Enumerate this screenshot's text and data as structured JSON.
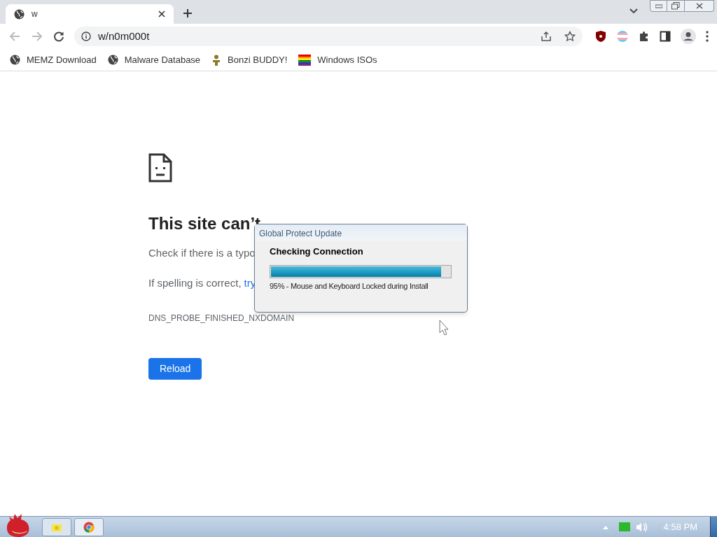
{
  "browser": {
    "tabs": [
      {
        "title": "w",
        "selected": true
      }
    ],
    "address": "w/n0m000t",
    "bookmarks": [
      {
        "kind": "globe",
        "label": "MEMZ Download"
      },
      {
        "kind": "globe",
        "label": "Malware Database"
      },
      {
        "kind": "figure",
        "label": "Bonzi BUDDY!"
      },
      {
        "kind": "rainbow",
        "label": "Windows ISOs"
      }
    ]
  },
  "error_page": {
    "heading": "This site can’t",
    "line_1": "Check if there is a typo",
    "line_2": "If spelling is correct,",
    "link": "try",
    "code": "DNS_PROBE_FINISHED_NXDOMAIN",
    "reload_button": "Reload"
  },
  "dialog": {
    "title": "Global Protect Update",
    "heading": "Checking Connection",
    "progress": {
      "level": 0.95
    },
    "status": "95% - Mouse and Keyboard Locked during Install"
  },
  "taskbar": {
    "clock": "4:58 PM"
  }
}
